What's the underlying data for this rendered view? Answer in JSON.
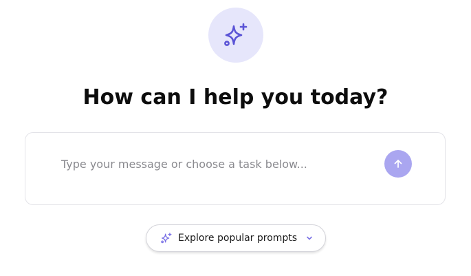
{
  "hero": {
    "icon": "sparkles-icon",
    "icon_bg": "#e6e6fb",
    "icon_color": "#5b54d6"
  },
  "title": "How can I help you today?",
  "composer": {
    "placeholder": "Type your message or choose a task below...",
    "value": "",
    "send_icon": "arrow-up-icon",
    "send_bg": "#aaa6f0"
  },
  "prompts": {
    "label": "Explore popular prompts",
    "icon": "sparkles-icon",
    "chevron": "chevron-down-icon",
    "accent": "#7b72e6"
  }
}
